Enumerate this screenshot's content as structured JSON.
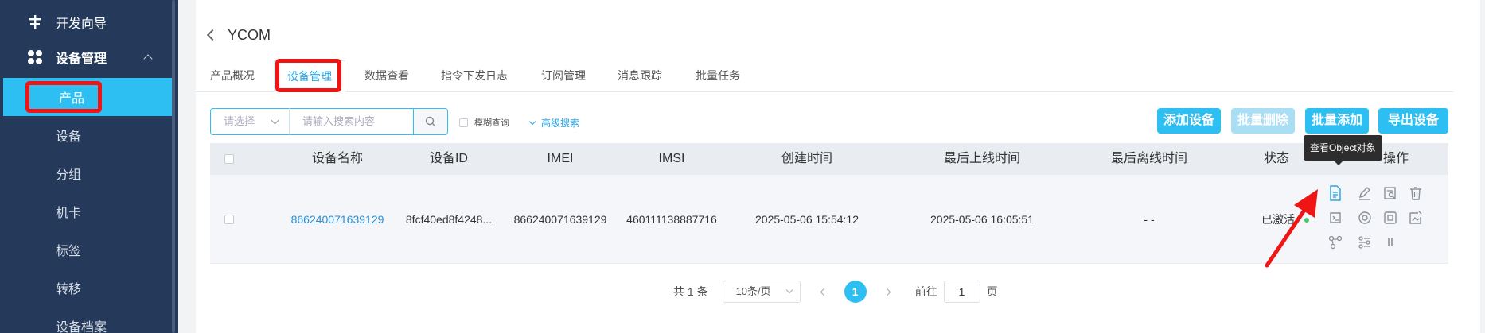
{
  "sidebar": {
    "items": [
      {
        "label": "开发向导",
        "icon": "sliders-icon"
      },
      {
        "label": "设备管理",
        "icon": "grid-icon"
      }
    ],
    "sub_items": [
      "产品",
      "设备",
      "分组",
      "机卡",
      "标签",
      "转移",
      "设备档案"
    ]
  },
  "header": {
    "title": "YCOM"
  },
  "tabs": [
    "产品概况",
    "设备管理",
    "数据查看",
    "指令下发日志",
    "订阅管理",
    "消息跟踪",
    "批量任务"
  ],
  "toolbar": {
    "select_placeholder": "请选择",
    "search_placeholder": "请输入搜索内容",
    "fuzzy_label": "模糊查询",
    "advanced_label": "高级搜索",
    "buttons": [
      "添加设备",
      "批量删除",
      "批量添加",
      "导出设备"
    ]
  },
  "table": {
    "columns": [
      "设备名称",
      "设备ID",
      "IMEI",
      "IMSI",
      "创建时间",
      "最后上线时间",
      "最后离线时间",
      "状态",
      "操作"
    ],
    "rows": [
      {
        "name": "866240071639129",
        "id": "8fcf40ed8f4248...",
        "imei": "866240071639129",
        "imsi": "460111138887716",
        "created": "2025-05-06 15:54:12",
        "last_online": "2025-05-06 16:05:51",
        "last_offline": "- -",
        "status": "已激活",
        "status_color": "#47c76d"
      }
    ],
    "tooltip": "查看Object对象"
  },
  "pagination": {
    "total": "共 1 条",
    "page_size": "10条/页",
    "current": "1",
    "goto_label": "前往",
    "goto_value": "1",
    "page_suffix": "页"
  },
  "colors": {
    "accent": "#2dbff2",
    "sidebar": "#253a5b",
    "highlight": "#f01515"
  }
}
